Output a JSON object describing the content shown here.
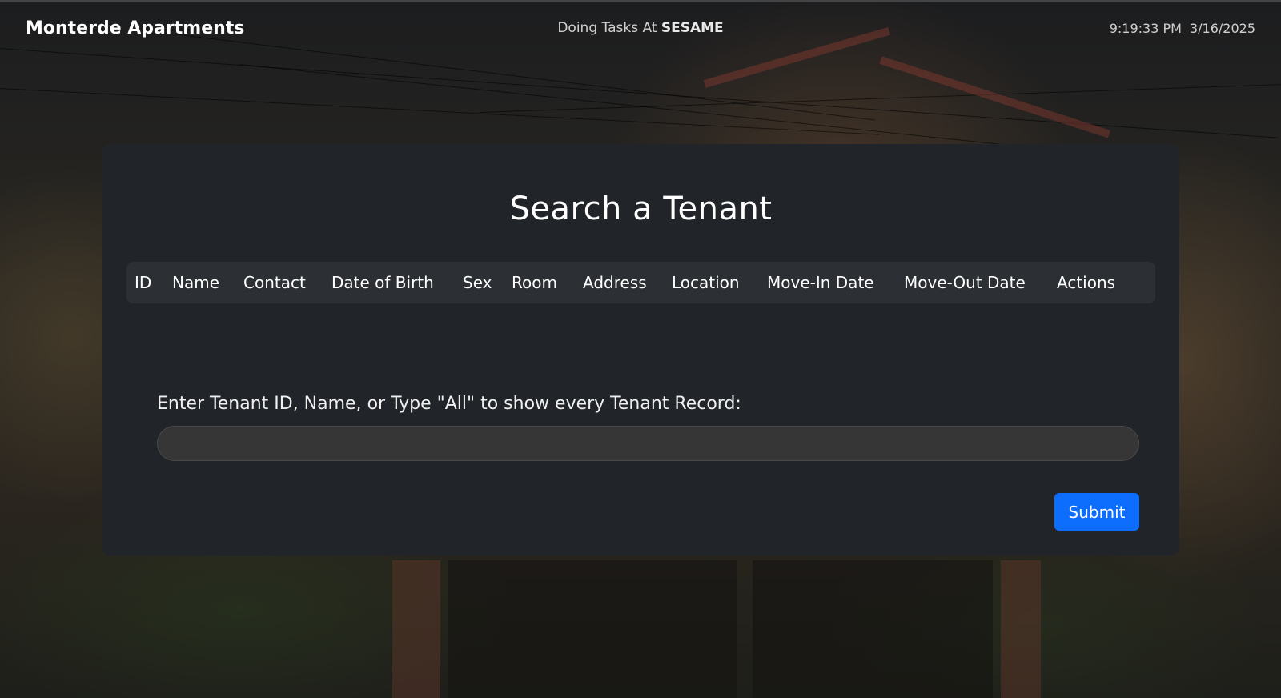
{
  "header": {
    "brand": "Monterde Apartments",
    "doing_prefix": "Doing Tasks At",
    "doing_location": "SESAME",
    "time": "9:19:33 PM",
    "date": "3/16/2025"
  },
  "search": {
    "title": "Search a Tenant",
    "columns": [
      "ID",
      "Name",
      "Contact",
      "Date of Birth",
      "Sex",
      "Room",
      "Address",
      "Location",
      "Move-In Date",
      "Move-Out Date",
      "Actions"
    ],
    "input_label": "Enter Tenant ID, Name, or Type \"All\" to show every Tenant Record:",
    "input_value": "",
    "input_placeholder": "",
    "submit_label": "Submit"
  },
  "colors": {
    "card_bg": "#212429",
    "table_head_bg": "#2c2f34",
    "submit_bg": "#0d6efd"
  }
}
